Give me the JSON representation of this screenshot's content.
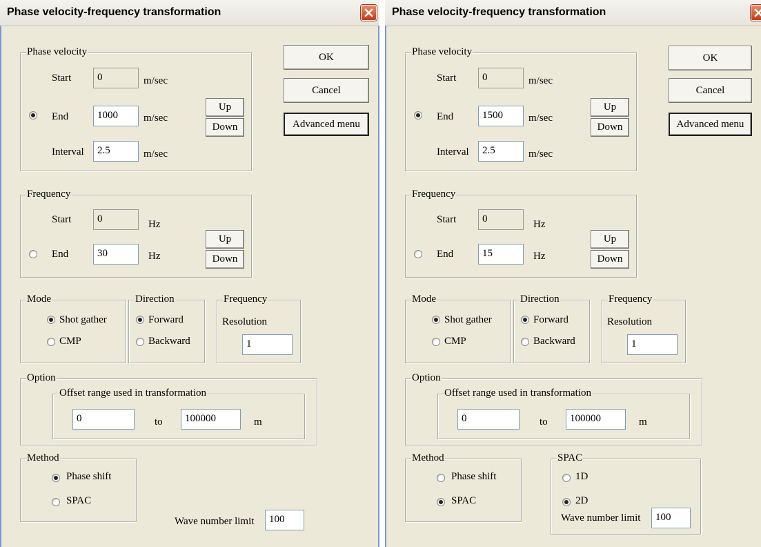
{
  "left": {
    "title": "Phase velocity-frequency transformation",
    "buttons": {
      "ok": "OK",
      "cancel": "Cancel",
      "advanced": "Advanced menu"
    },
    "phase_velocity": {
      "legend": "Phase velocity",
      "start_label": "Start",
      "start_value": "0",
      "start_unit": "m/sec",
      "end_label": "End",
      "end_value": "1000",
      "end_unit": "m/sec",
      "interval_label": "Interval",
      "interval_value": "2.5",
      "interval_unit": "m/sec",
      "up": "Up",
      "down": "Down",
      "end_selected": true
    },
    "frequency": {
      "legend": "Frequency",
      "start_label": "Start",
      "start_value": "0",
      "start_unit": "Hz",
      "end_label": "End",
      "end_value": "30",
      "end_unit": "Hz",
      "up": "Up",
      "down": "Down",
      "end_selected": false
    },
    "mode": {
      "legend": "Mode",
      "opt1": "Shot gather",
      "opt2": "CMP",
      "selected": "Shot gather"
    },
    "direction": {
      "legend": "Direction",
      "opt1": "Forward",
      "opt2": "Backward",
      "selected": "Forward"
    },
    "freq_res": {
      "legend": "Frequency",
      "label": "Resolution",
      "value": "1"
    },
    "option": {
      "legend": "Option",
      "sub_legend": "Offset range used in transformation",
      "from": "0",
      "to_label": "to",
      "to": "100000",
      "unit": "m"
    },
    "method": {
      "legend": "Method",
      "opt1": "Phase shift",
      "opt2": "SPAC",
      "selected": "Phase shift"
    },
    "wave_number": {
      "label": "Wave number limit",
      "value": "100"
    }
  },
  "right": {
    "title": "Phase velocity-frequency transformation",
    "buttons": {
      "ok": "OK",
      "cancel": "Cancel",
      "advanced": "Advanced menu"
    },
    "phase_velocity": {
      "legend": "Phase velocity",
      "start_label": "Start",
      "start_value": "0",
      "start_unit": "m/sec",
      "end_label": "End",
      "end_value": "1500",
      "end_unit": "m/sec",
      "interval_label": "Interval",
      "interval_value": "2.5",
      "interval_unit": "m/sec",
      "up": "Up",
      "down": "Down",
      "end_selected": true
    },
    "frequency": {
      "legend": "Frequency",
      "start_label": "Start",
      "start_value": "0",
      "start_unit": "Hz",
      "end_label": "End",
      "end_value": "15",
      "end_unit": "Hz",
      "up": "Up",
      "down": "Down",
      "end_selected": false
    },
    "mode": {
      "legend": "Mode",
      "opt1": "Shot gather",
      "opt2": "CMP",
      "selected": "Shot gather"
    },
    "direction": {
      "legend": "Direction",
      "opt1": "Forward",
      "opt2": "Backward",
      "selected": "Forward"
    },
    "freq_res": {
      "legend": "Frequency",
      "label": "Resolution",
      "value": "1"
    },
    "option": {
      "legend": "Option",
      "sub_legend": "Offset range used in transformation",
      "from": "0",
      "to_label": "to",
      "to": "100000",
      "unit": "m"
    },
    "method": {
      "legend": "Method",
      "opt1": "Phase shift",
      "opt2": "SPAC",
      "selected": "SPAC"
    },
    "spac": {
      "legend": "SPAC",
      "opt1": "1D",
      "opt2": "2D",
      "selected": "2D"
    },
    "wave_number": {
      "label": "Wave number limit",
      "value": "100"
    }
  },
  "colors": {
    "dialog_bg": "#ece9d8",
    "close_button": "#c23c17",
    "field_border": "#7f9db9"
  }
}
